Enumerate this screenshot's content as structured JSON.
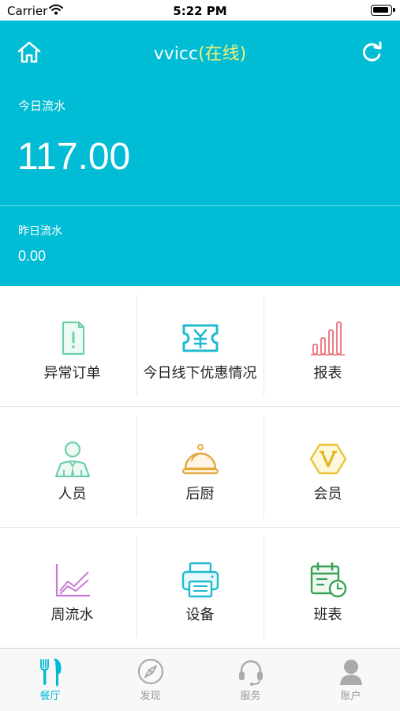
{
  "status_bar": {
    "carrier": "Carrier",
    "time": "5:22 PM"
  },
  "header": {
    "title": "vvicc",
    "status": "(在线)",
    "today_label": "今日流水",
    "today_value": "117.00",
    "yesterday_label": "昨日流水",
    "yesterday_value": "0.00"
  },
  "grid": {
    "items": [
      {
        "label": "异常订单",
        "icon": "abnormal-order-icon"
      },
      {
        "label": "今日线下优惠情况",
        "icon": "coupon-ticket-icon"
      },
      {
        "label": "报表",
        "icon": "bar-chart-icon"
      },
      {
        "label": "人员",
        "icon": "staff-person-icon"
      },
      {
        "label": "后厨",
        "icon": "food-cloche-icon"
      },
      {
        "label": "会员",
        "icon": "member-v-icon"
      },
      {
        "label": "周流水",
        "icon": "line-chart-icon"
      },
      {
        "label": "设备",
        "icon": "printer-icon"
      },
      {
        "label": "班表",
        "icon": "schedule-calendar-icon"
      }
    ]
  },
  "tabbar": {
    "items": [
      {
        "label": "餐厅",
        "icon": "fork-knife-icon"
      },
      {
        "label": "发现",
        "icon": "compass-icon"
      },
      {
        "label": "服务",
        "icon": "headset-icon"
      },
      {
        "label": "账户",
        "icon": "account-person-icon"
      }
    ]
  },
  "colors": {
    "primary": "#00bcd4",
    "status_online": "#f2f276",
    "tab_inactive": "#999999"
  }
}
